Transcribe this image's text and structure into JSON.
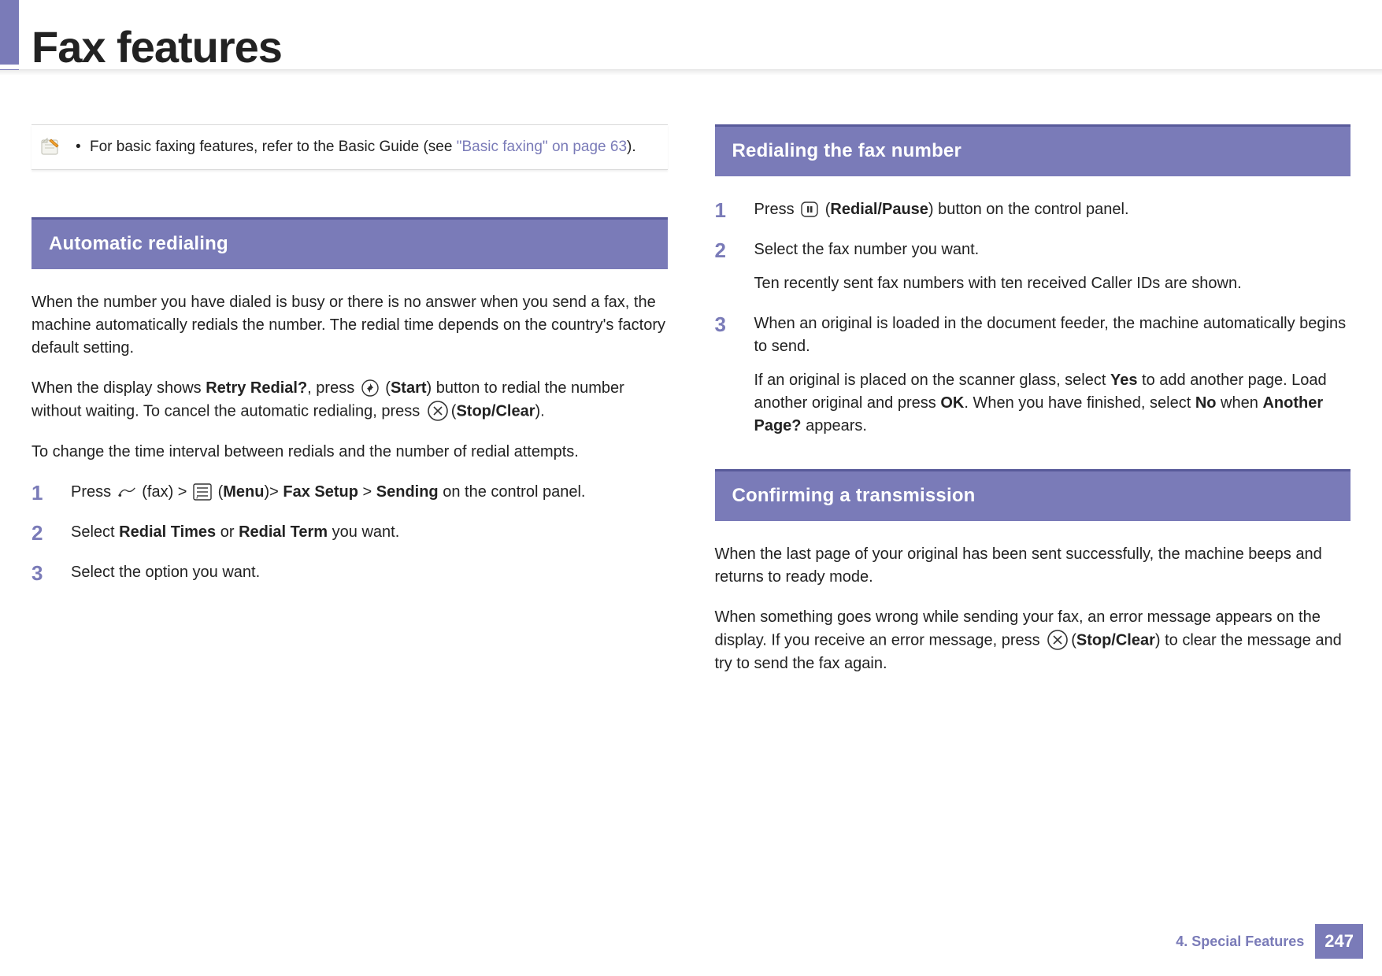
{
  "header": {
    "title": "Fax features"
  },
  "note": {
    "text_before_link": "For basic faxing features, refer to the Basic Guide (see ",
    "link_text": "\"Basic faxing\" on page 63",
    "text_after_link": ")."
  },
  "left": {
    "section1": {
      "heading": "Automatic redialing",
      "para1": "When the number you have dialed is busy or there is no answer when you send a fax, the machine automatically redials the number. The redial time depends on the country's factory default setting.",
      "para2_a": " When the display shows ",
      "para2_b": "Retry Redial?",
      "para2_c": ", press ",
      "para2_d": " (",
      "para2_e": "Start",
      "para2_f": ") button to redial the number without waiting. To cancel the automatic redialing, press ",
      "para2_g": "(",
      "para2_h": "Stop/Clear",
      "para2_i": ").",
      "para3": "To change the time interval between redials and the number of redial attempts.",
      "steps": [
        {
          "num": "1",
          "t1": "Press ",
          "t2": " (fax) > ",
          "t3": " (",
          "t4": "Menu",
          "t5": ")> ",
          "t6": "Fax Setup",
          "t7": " > ",
          "t8": "Sending",
          "t9": " on the control panel."
        },
        {
          "num": "2",
          "t1": "Select ",
          "t2": "Redial Times",
          "t3": " or ",
          "t4": "Redial Term",
          "t5": " you want."
        },
        {
          "num": "3",
          "t1": "Select the option you want."
        }
      ]
    }
  },
  "right": {
    "section1": {
      "heading": "Redialing the fax number",
      "steps": [
        {
          "num": "1",
          "t1": "Press ",
          "t2": " (",
          "t3": "Redial/Pause",
          "t4": ") button on the control panel."
        },
        {
          "num": "2",
          "p1": "Select the fax number you want.",
          "p2": "Ten recently sent fax numbers with ten received Caller IDs are shown."
        },
        {
          "num": "3",
          "p1": "When an original is loaded in the document feeder, the machine automatically begins to send.",
          "p2a": "If an original is placed on the scanner glass, select ",
          "p2b": "Yes",
          "p2c": " to add another page. Load another original and press ",
          "p2d": "OK",
          "p2e": ". When you have finished, select ",
          "p2f": "No",
          "p2g": " when ",
          "p2h": "Another Page?",
          "p2i": " appears."
        }
      ]
    },
    "section2": {
      "heading": "Confirming a transmission",
      "para1": "When the last page of your original has been sent successfully, the machine beeps and returns to ready mode.",
      "para2a": "When something goes wrong while sending your fax, an error message appears on the display. If you receive an error message, press ",
      "para2b": "(",
      "para2c": "Stop/Clear",
      "para2d": ") to clear the message and try to send the fax again."
    }
  },
  "footer": {
    "chapter": "4.  Special Features",
    "page": "247"
  }
}
